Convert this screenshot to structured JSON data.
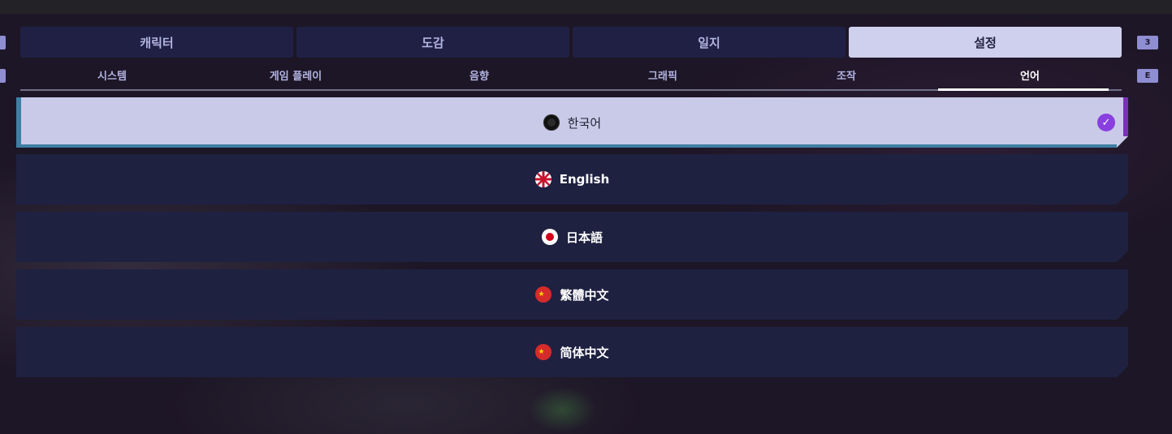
{
  "hotkeys": {
    "tab_next": "3",
    "subtab_next": "E"
  },
  "main_tabs": [
    {
      "label": "캐릭터",
      "active": false
    },
    {
      "label": "도감",
      "active": false
    },
    {
      "label": "일지",
      "active": false
    },
    {
      "label": "설정",
      "active": true
    }
  ],
  "settings_tabs": [
    {
      "label": "시스템",
      "active": false
    },
    {
      "label": "게임 플레이",
      "active": false
    },
    {
      "label": "음향",
      "active": false
    },
    {
      "label": "그래픽",
      "active": false
    },
    {
      "label": "조작",
      "active": false
    },
    {
      "label": "언어",
      "active": true
    }
  ],
  "languages": [
    {
      "label": "한국어",
      "flag": "korea-flag-icon",
      "selected": true
    },
    {
      "label": "English",
      "flag": "uk-flag-icon",
      "selected": false
    },
    {
      "label": "日本語",
      "flag": "japan-flag-icon",
      "selected": false
    },
    {
      "label": "繁體中文",
      "flag": "china-flag-icon",
      "selected": false
    },
    {
      "label": "简体中文",
      "flag": "china-flag-icon",
      "selected": false
    }
  ],
  "colors": {
    "accent_purple": "#8a3fe0",
    "selected_row": "#c9cae8",
    "row_bg": "#1f2141",
    "tab_active": "#cfd0ed"
  }
}
